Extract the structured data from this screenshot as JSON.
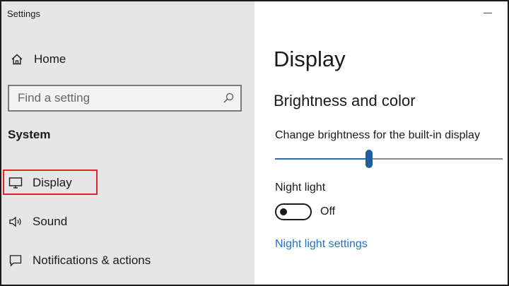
{
  "window": {
    "title": "Settings"
  },
  "sidebar": {
    "home": {
      "label": "Home",
      "icon": "home-icon"
    },
    "search": {
      "placeholder": "Find a setting",
      "value": "",
      "icon": "search-icon"
    },
    "section_title": "System",
    "items": [
      {
        "label": "Display",
        "icon": "monitor-icon",
        "selected": true,
        "highlight_color": "#e0242a"
      },
      {
        "label": "Sound",
        "icon": "speaker-icon",
        "selected": false
      },
      {
        "label": "Notifications & actions",
        "icon": "notification-icon",
        "selected": false
      }
    ]
  },
  "main": {
    "page_title": "Display",
    "section_title": "Brightness and color",
    "brightness": {
      "label": "Change brightness for the built-in display",
      "level_fraction": 0.41
    },
    "night_light": {
      "label": "Night light",
      "state": "Off",
      "on": false,
      "settings_link": "Night light settings"
    }
  },
  "colors": {
    "sidebar_bg": "#e6e6e6",
    "accent": "#1f5f9e",
    "link": "#1f74c8",
    "highlight": "#e0242a"
  }
}
